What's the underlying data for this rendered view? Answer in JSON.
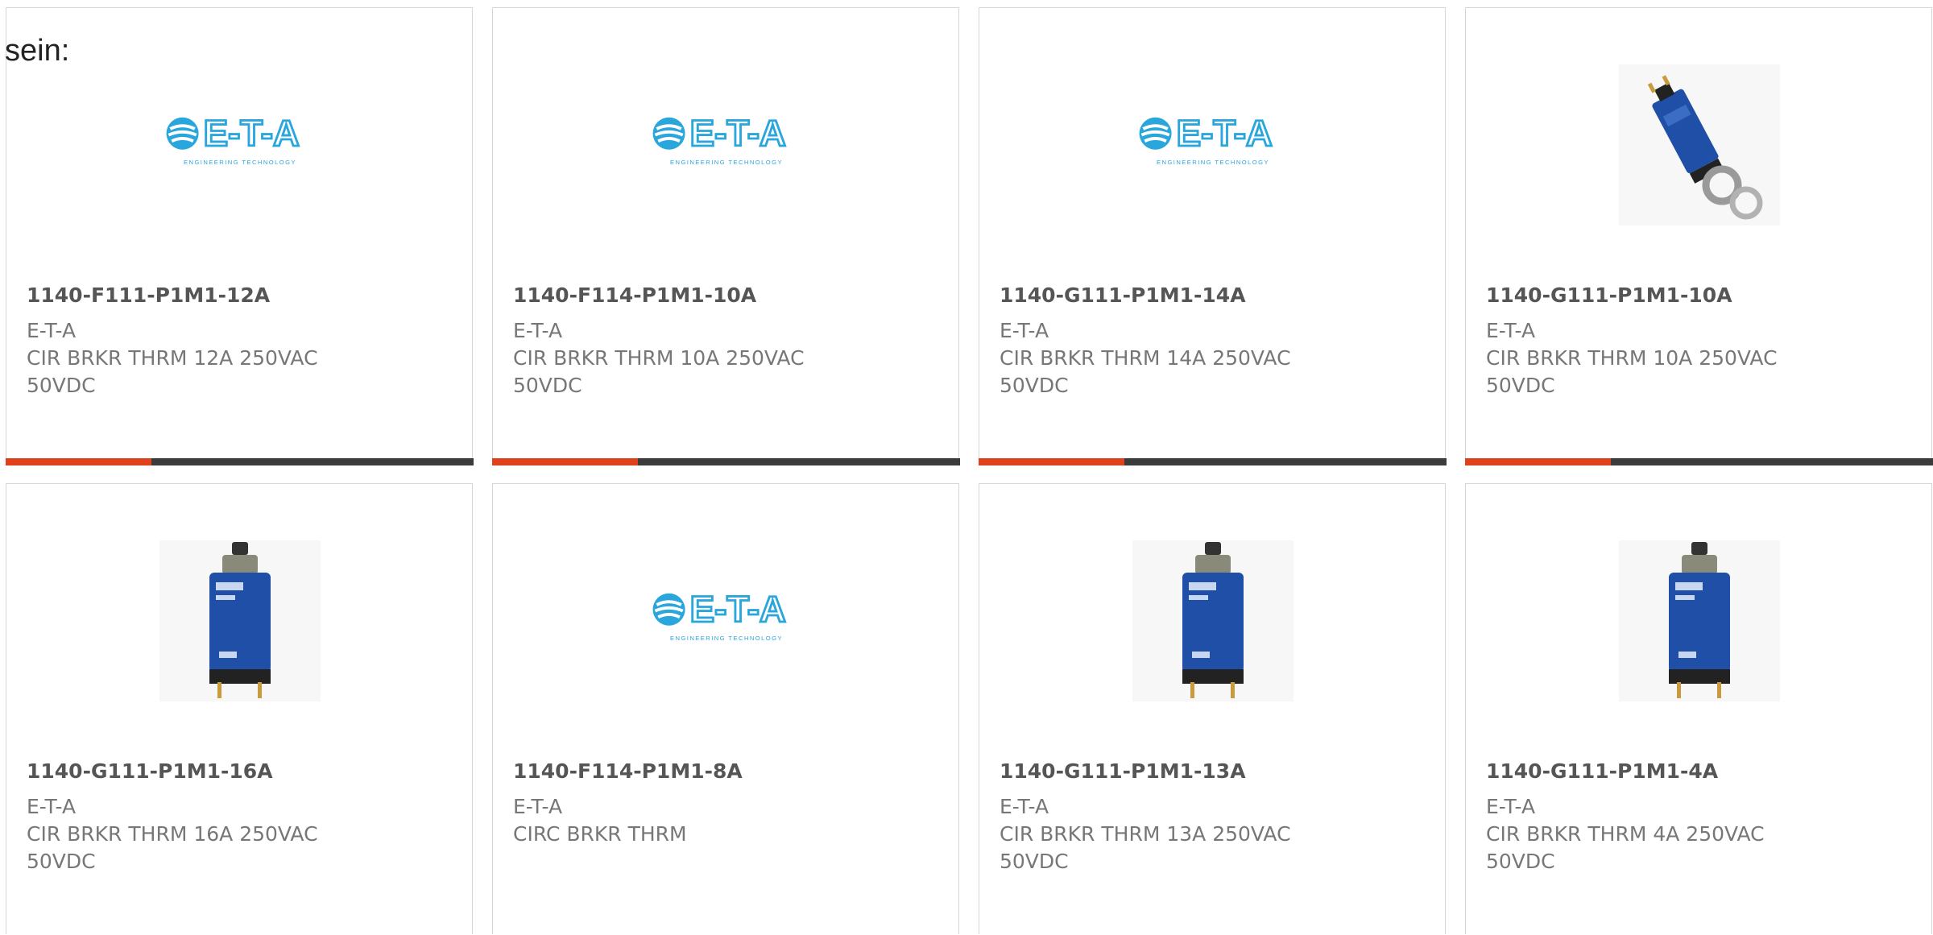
{
  "intro_text": "sein:",
  "colors": {
    "accent_bar": "#e0401a",
    "dark_bar": "#3b3b3b",
    "logo_blue": "#29a6dc",
    "breaker_blue": "#1f4fa6"
  },
  "products": [
    {
      "part": "1140-F111-P1M1-12A",
      "manufacturer": "E-T-A",
      "description": "CIR BRKR THRM 12A 250VAC 50VDC",
      "image": "eta-logo",
      "logo_tagline": "ENGINEERING TECHNOLOGY"
    },
    {
      "part": "1140-F114-P1M1-10A",
      "manufacturer": "E-T-A",
      "description": "CIR BRKR THRM 10A 250VAC 50VDC",
      "image": "eta-logo",
      "logo_tagline": "ENGINEERING TECHNOLOGY"
    },
    {
      "part": "1140-G111-P1M1-14A",
      "manufacturer": "E-T-A",
      "description": "CIR BRKR THRM 14A 250VAC 50VDC",
      "image": "eta-logo",
      "logo_tagline": "ENGINEERING TECHNOLOGY"
    },
    {
      "part": "1140-G111-P1M1-10A",
      "manufacturer": "E-T-A",
      "description": "CIR BRKR THRM 10A 250VAC 50VDC",
      "image": "breaker-side-photo"
    },
    {
      "part": "1140-G111-P1M1-16A",
      "manufacturer": "E-T-A",
      "description": "CIR BRKR THRM 16A 250VAC 50VDC",
      "image": "breaker-front-photo"
    },
    {
      "part": "1140-F114-P1M1-8A",
      "manufacturer": "E-T-A",
      "description": "CIRC BRKR THRM",
      "image": "eta-logo",
      "logo_tagline": "ENGINEERING TECHNOLOGY"
    },
    {
      "part": "1140-G111-P1M1-13A",
      "manufacturer": "E-T-A",
      "description": "CIR BRKR THRM 13A 250VAC 50VDC",
      "image": "breaker-front-photo"
    },
    {
      "part": "1140-G111-P1M1-4A",
      "manufacturer": "E-T-A",
      "description": "CIR BRKR THRM 4A 250VAC 50VDC",
      "image": "breaker-front-photo"
    }
  ]
}
